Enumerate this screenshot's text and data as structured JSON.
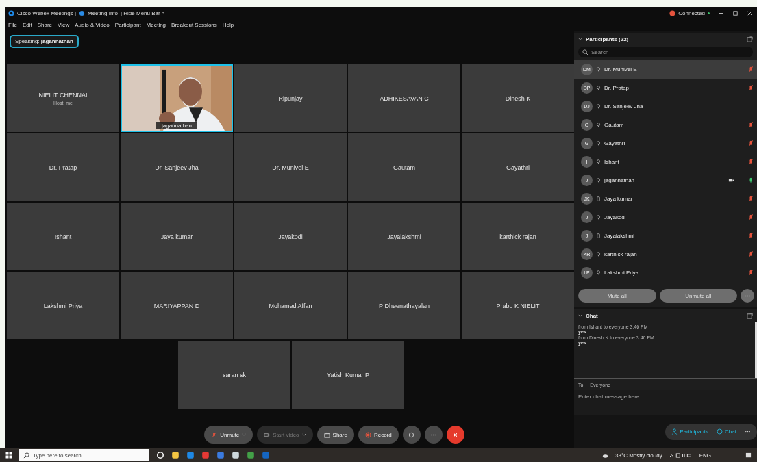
{
  "title_bar": {
    "app": "Cisco Webex Meetings |",
    "meeting_info": "Meeting Info",
    "hide_menu": "| Hide Menu Bar ^",
    "status": "Connected"
  },
  "menu": [
    "File",
    "Edit",
    "Share",
    "View",
    "Audio & Video",
    "Participant",
    "Meeting",
    "Breakout Sessions",
    "Help"
  ],
  "speaking": "Speaking: **jagannathan**",
  "tile_rows": [
    [
      {
        "kind": "name",
        "name": "NIELIT CHENNAI",
        "subtitle": "Host, me"
      },
      {
        "kind": "video",
        "name": "jagannathan"
      },
      {
        "kind": "name",
        "name": "Ripunjay"
      },
      {
        "kind": "name",
        "name": "ADHIKESAVAN C"
      },
      {
        "kind": "name",
        "name": "Dinesh K"
      }
    ],
    [
      {
        "kind": "name",
        "name": "Dr. Pratap"
      },
      {
        "kind": "name",
        "name": "Dr. Sanjeev Jha"
      },
      {
        "kind": "name",
        "name": "Dr. Munivel E"
      },
      {
        "kind": "name",
        "name": "Gautam"
      },
      {
        "kind": "name",
        "name": "Gayathri"
      }
    ],
    [
      {
        "kind": "name",
        "name": "Ishant"
      },
      {
        "kind": "name",
        "name": "Jaya kumar"
      },
      {
        "kind": "name",
        "name": "Jayakodi"
      },
      {
        "kind": "name",
        "name": "Jayalakshmi"
      },
      {
        "kind": "name",
        "name": "karthick rajan"
      }
    ],
    [
      {
        "kind": "name",
        "name": "Lakshmi Priya"
      },
      {
        "kind": "name",
        "name": "MARIYAPPAN D"
      },
      {
        "kind": "name",
        "name": "Mohamed Affan"
      },
      {
        "kind": "name",
        "name": "P Dheenathayalan"
      },
      {
        "kind": "name",
        "name": "Prabu K NIELIT"
      }
    ],
    [
      {
        "kind": "name",
        "name": "saran sk"
      },
      {
        "kind": "name",
        "name": "Yatish Kumar P"
      }
    ]
  ],
  "controls": [
    {
      "kind": "unmute",
      "label": "Unmute",
      "disabled": false
    },
    {
      "kind": "video",
      "label": "Start video",
      "disabled": true
    },
    {
      "kind": "share",
      "label": "Share",
      "disabled": false
    },
    {
      "kind": "record",
      "label": "Record",
      "disabled": false
    },
    {
      "kind": "reactions",
      "disabled": false
    },
    {
      "kind": "more",
      "disabled": false
    },
    {
      "kind": "leave",
      "disabled": false
    }
  ],
  "participants": {
    "title": "Participants (22)",
    "search_placeholder": "Search",
    "items": [
      {
        "initials": "DM",
        "name": "Dr. Munivel E",
        "phone": false,
        "video": false,
        "mic_shown": true,
        "muted": true,
        "selected": true
      },
      {
        "initials": "DP",
        "name": "Dr. Pratap",
        "phone": false,
        "video": false,
        "mic_shown": true,
        "muted": true,
        "selected": false
      },
      {
        "initials": "DJ",
        "name": "Dr. Sanjeev Jha",
        "phone": false,
        "video": false,
        "mic_shown": false,
        "selected": false
      },
      {
        "initials": "G",
        "name": "Gautam",
        "phone": false,
        "video": false,
        "mic_shown": true,
        "muted": true,
        "selected": false
      },
      {
        "initials": "G",
        "name": "Gayathri",
        "phone": false,
        "video": false,
        "mic_shown": true,
        "muted": true,
        "selected": false
      },
      {
        "initials": "I",
        "name": "Ishant",
        "phone": false,
        "video": false,
        "mic_shown": true,
        "muted": true,
        "selected": false
      },
      {
        "initials": "J",
        "name": "jagannathan",
        "phone": false,
        "video": true,
        "mic_shown": true,
        "muted": false,
        "selected": false
      },
      {
        "initials": "JK",
        "name": "Jaya kumar",
        "phone": true,
        "video": false,
        "mic_shown": true,
        "muted": true,
        "selected": false
      },
      {
        "initials": "J",
        "name": "Jayakodi",
        "phone": false,
        "video": false,
        "mic_shown": true,
        "muted": true,
        "selected": false
      },
      {
        "initials": "J",
        "name": "Jayalakshmi",
        "phone": true,
        "video": false,
        "mic_shown": true,
        "muted": true,
        "selected": false
      },
      {
        "initials": "KR",
        "name": "karthick rajan",
        "phone": false,
        "video": false,
        "mic_shown": true,
        "muted": true,
        "selected": false
      },
      {
        "initials": "LP",
        "name": "Lakshmi Priya",
        "phone": false,
        "video": false,
        "mic_shown": true,
        "muted": true,
        "selected": false
      }
    ],
    "buttons": [
      "Mute all",
      "Unmute all"
    ]
  },
  "chat": {
    "title": "Chat",
    "messages": [
      {
        "header": "from Ishant to everyone   3:46 PM",
        "text": "yes"
      },
      {
        "header": "from Dinesh K to everyone   3:46 PM",
        "text": "yes"
      }
    ],
    "to_label": "To:",
    "to_value": "Everyone",
    "placeholder": "Enter chat message here"
  },
  "panel_tabs": [
    {
      "label": "Participants",
      "selected": true
    },
    {
      "label": "Chat",
      "selected": true
    }
  ],
  "taskbar": {
    "search_placeholder": "Type here to search",
    "weather": "33°C Mostly cloudy",
    "language": "ENG"
  }
}
